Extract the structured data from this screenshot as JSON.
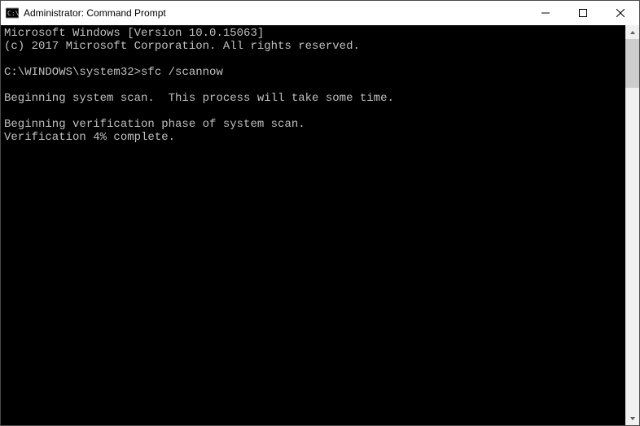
{
  "window": {
    "title": "Administrator: Command Prompt"
  },
  "terminal": {
    "lines": {
      "l0": "Microsoft Windows [Version 10.0.15063]",
      "l1": "(c) 2017 Microsoft Corporation. All rights reserved.",
      "l2": "",
      "l3_prompt": "C:\\WINDOWS\\system32>",
      "l3_cmd": "sfc /scannow",
      "l4": "",
      "l5": "Beginning system scan.  This process will take some time.",
      "l6": "",
      "l7": "Beginning verification phase of system scan.",
      "l8": "Verification 4% complete."
    }
  }
}
